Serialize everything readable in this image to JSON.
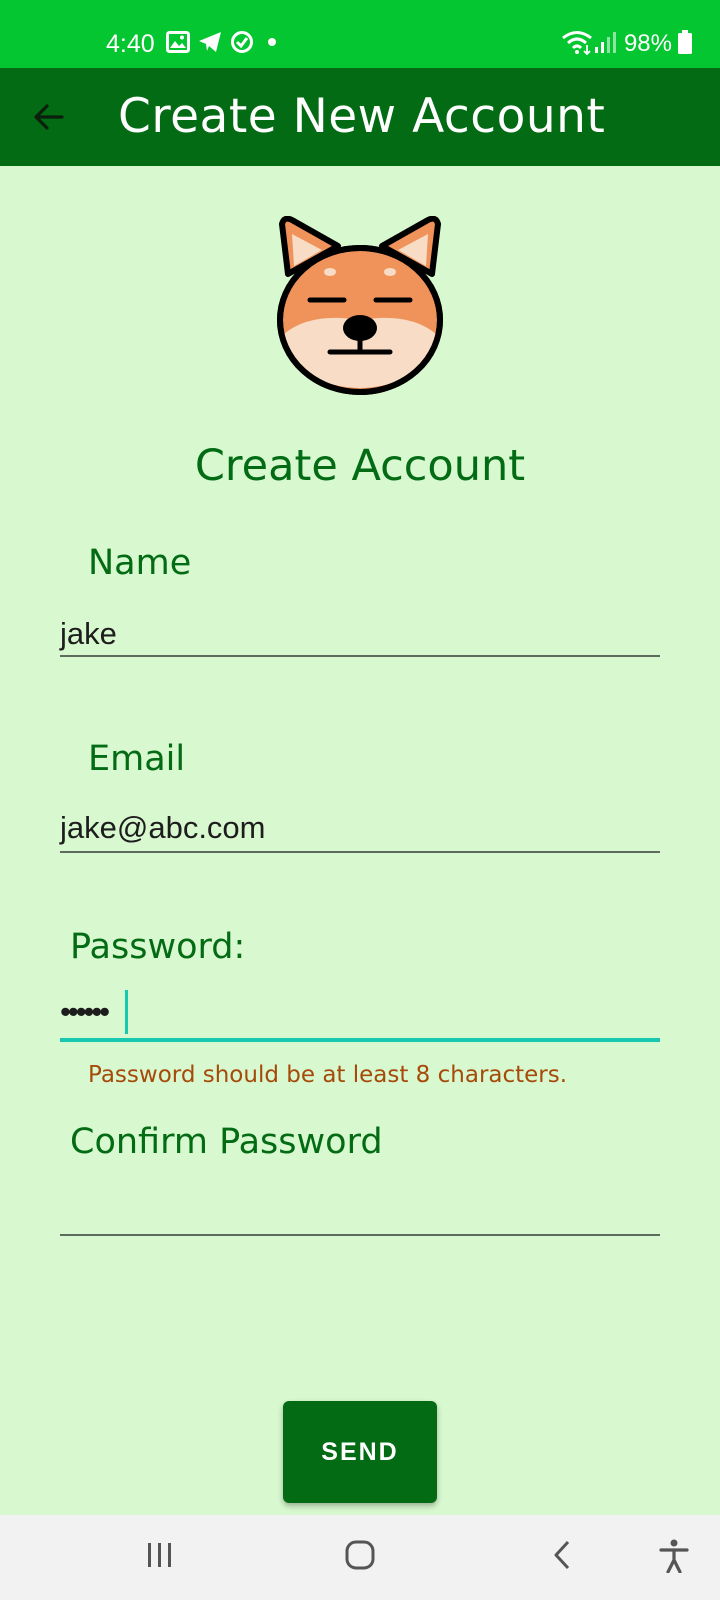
{
  "status_bar": {
    "time": "4:40",
    "battery": "98%",
    "icons": [
      "gallery-icon",
      "telegram-icon",
      "check-circle-icon",
      "dot-icon",
      "wifi-icon",
      "signal-icon",
      "battery-icon"
    ]
  },
  "app_bar": {
    "title": "Create New Account",
    "back_icon": "back-arrow-icon"
  },
  "form": {
    "heading": "Create Account",
    "name_label": "Name",
    "name_value": "jake",
    "email_label": "Email",
    "email_value": "jake@abc.com",
    "password_label": "Password:",
    "password_value": "••••••",
    "password_error": "Password should be at least 8 characters.",
    "confirm_label": "Confirm Password",
    "confirm_value": "",
    "send_label": "SEND"
  },
  "nav_bar": {
    "icons": [
      "recent-apps-icon",
      "home-icon",
      "back-icon",
      "accessibility-icon"
    ]
  },
  "colors": {
    "status_bar": "#03c630",
    "app_bar": "#036b14",
    "background": "#d8f8cf",
    "accent": "#19c8b0",
    "error": "#a64a0a"
  }
}
